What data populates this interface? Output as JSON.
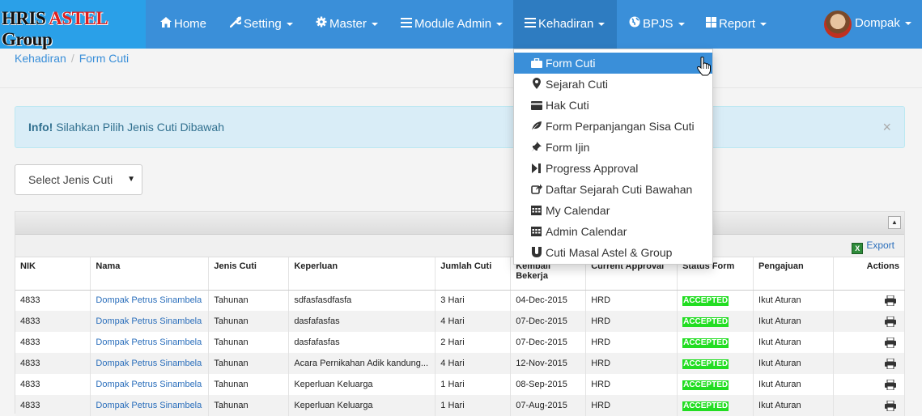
{
  "brand": {
    "part1": "HRIS ",
    "part2": "ASTEL",
    "part3": " Group"
  },
  "nav": {
    "home": "Home",
    "setting": "Setting",
    "master": "Master",
    "module_admin": "Module Admin",
    "kehadiran": "Kehadiran",
    "bpjs": "BPJS",
    "report": "Report",
    "user": "Dompak"
  },
  "breadcrumb": {
    "root": "Kehadiran",
    "current": "Form Cuti"
  },
  "alert": {
    "title": "Info!",
    "message": "Silahkan Pilih Jenis Cuti Dibawah",
    "close": "×"
  },
  "select": {
    "value": "Select Jenis Cuti"
  },
  "toolbar": {
    "export": "Export"
  },
  "dropdown": [
    {
      "label": "Form Cuti",
      "icon": "briefcase-icon"
    },
    {
      "label": "Sejarah Cuti",
      "icon": "map-marker-icon"
    },
    {
      "label": "Hak Cuti",
      "icon": "credit-card-icon"
    },
    {
      "label": "Form Perpanjangan Sisa Cuti",
      "icon": "leaf-icon"
    },
    {
      "label": "Form Ijin",
      "icon": "pushpin-icon"
    },
    {
      "label": "Progress Approval",
      "icon": "step-forward-icon"
    },
    {
      "label": "Daftar Sejarah Cuti Bawahan",
      "icon": "share-icon"
    },
    {
      "label": "My Calendar",
      "icon": "calendar-icon"
    },
    {
      "label": "Admin Calendar",
      "icon": "calendar-icon"
    },
    {
      "label": "Cuti Masal Astel & Group",
      "icon": "magnet-icon"
    }
  ],
  "table": {
    "headers": [
      "NIK",
      "Nama",
      "Jenis Cuti",
      "Keperluan",
      "Jumlah Cuti",
      "Kembali Bekerja",
      "Current Approval",
      "Status Form",
      "Pengajuan",
      "Actions"
    ],
    "rows": [
      [
        "4833",
        "Dompak Petrus Sinambela",
        "Tahunan",
        "sdfasfasdfasfa",
        "3 Hari",
        "04-Dec-2015",
        "HRD",
        "ACCEPTED",
        "Ikut Aturan"
      ],
      [
        "4833",
        "Dompak Petrus Sinambela",
        "Tahunan",
        "dasfafasfas",
        "4 Hari",
        "07-Dec-2015",
        "HRD",
        "ACCEPTED",
        "Ikut Aturan"
      ],
      [
        "4833",
        "Dompak Petrus Sinambela",
        "Tahunan",
        "dasfafasfas",
        "2 Hari",
        "07-Dec-2015",
        "HRD",
        "ACCEPTED",
        "Ikut Aturan"
      ],
      [
        "4833",
        "Dompak Petrus Sinambela",
        "Tahunan",
        "Acara Pernikahan Adik kandung...",
        "4 Hari",
        "12-Nov-2015",
        "HRD",
        "ACCEPTED",
        "Ikut Aturan"
      ],
      [
        "4833",
        "Dompak Petrus Sinambela",
        "Tahunan",
        "Keperluan Keluarga",
        "1 Hari",
        "08-Sep-2015",
        "HRD",
        "ACCEPTED",
        "Ikut Aturan"
      ],
      [
        "4833",
        "Dompak Petrus Sinambela",
        "Tahunan",
        "Keperluan Keluarga",
        "1 Hari",
        "07-Aug-2015",
        "HRD",
        "ACCEPTED",
        "Ikut Aturan"
      ]
    ]
  },
  "colors": {
    "navbar": "#3a8fd9",
    "accepted": "#22dd22",
    "link": "#2a6ebb"
  }
}
